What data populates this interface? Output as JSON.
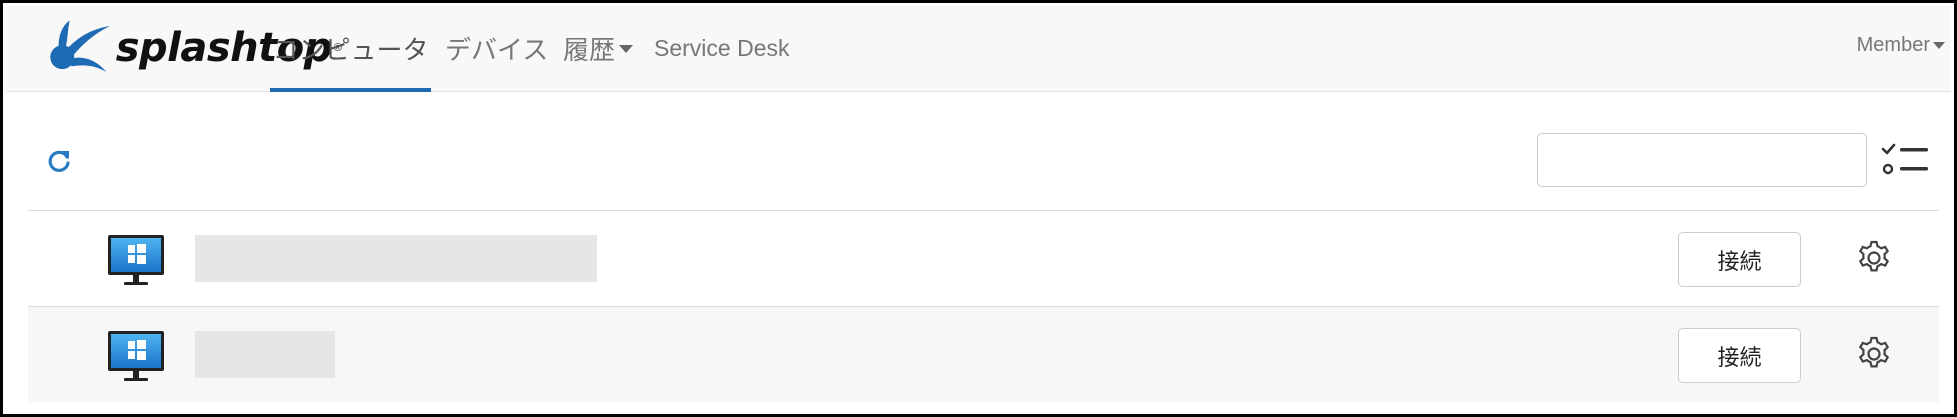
{
  "app": {
    "logo_text": "splashtop",
    "logo_tm": "®"
  },
  "nav": {
    "tabs": [
      {
        "label": "コンピュータ",
        "active": true
      },
      {
        "label": "デバイス",
        "active": false
      },
      {
        "label": "履歴",
        "active": false,
        "dropdown": true
      },
      {
        "label": "Service Desk",
        "active": false
      }
    ],
    "user_menu_label": "Member"
  },
  "toolbar": {
    "refresh_icon": "refresh-icon",
    "search_value": "",
    "search_placeholder": "",
    "filter_icon": "checklist-filter-icon"
  },
  "computers": [
    {
      "os_icon": "windows-monitor-icon",
      "name": "",
      "connect_label": "接続",
      "settings_icon": "gear-icon"
    },
    {
      "os_icon": "windows-monitor-icon",
      "name": "",
      "connect_label": "接続",
      "settings_icon": "gear-icon"
    }
  ],
  "colors": {
    "brand_blue": "#1f6bb3",
    "refresh_blue": "#2b7bc4",
    "nav_bg": "#f8f8f8"
  }
}
